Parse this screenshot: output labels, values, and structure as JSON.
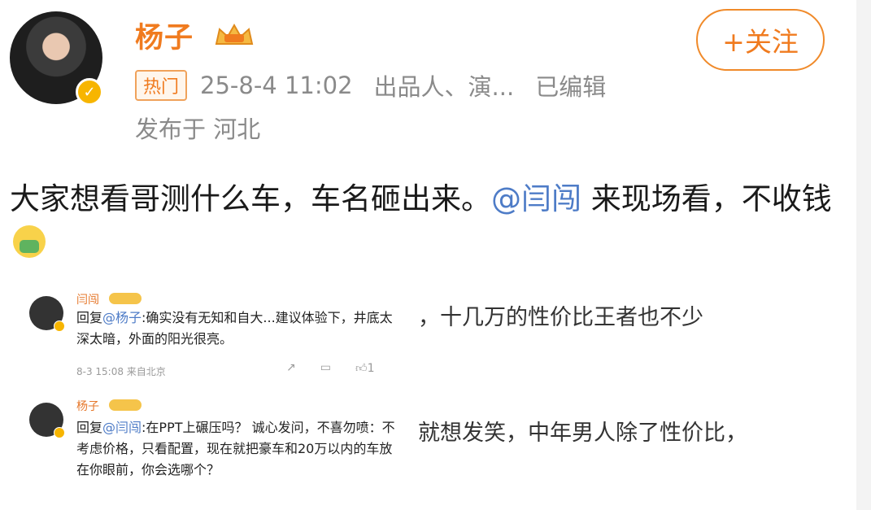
{
  "header": {
    "username": "杨子",
    "follow_label": "+关注",
    "hot_tag": "热门",
    "timestamp": "25-8-4 11:02",
    "author_desc": "出品人、演...",
    "edited": "已编辑",
    "location": "发布于 河北"
  },
  "post": {
    "text_before": "大家想看哥测什么车，车名砸出来。",
    "mention": "@闫闯",
    "text_after": " 来现场看，不收钱"
  },
  "screenshot": {
    "comment1": {
      "name": "闫闯",
      "reply_prefix": "回复",
      "reply_to": "@杨子",
      "text": ":确实没有无知和自大...建议体验下，井底太深太暗，外面的阳光很亮。",
      "meta": "8-3 15:08 来自北京",
      "like_count": "1"
    },
    "comment2": {
      "name": "杨子",
      "reply_prefix": "回复",
      "reply_to": "@闫闯",
      "text": ":在PPT上碾压吗？ 诚心发问，不喜勿喷：不考虑价格，只看配置，现在就把豪车和20万以内的车放在你眼前，你会选哪个？"
    },
    "bg_line1": "，十几万的性价比王者也不少",
    "bg_line2": "就想发笑，中年男人除了性价比，"
  }
}
